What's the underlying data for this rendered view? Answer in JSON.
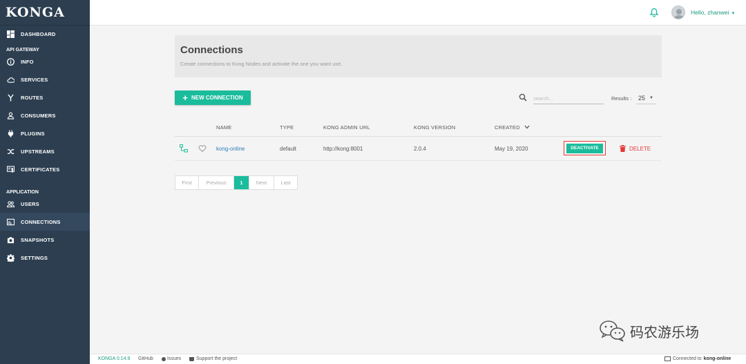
{
  "app": {
    "logo": "KONGA"
  },
  "sidebar": {
    "dashboard": {
      "label": "DASHBOARD"
    },
    "api_gateway_section": "API GATEWAY",
    "api_items": [
      {
        "label": "INFO",
        "icon": "info-icon"
      },
      {
        "label": "SERVICES",
        "icon": "cloud-icon"
      },
      {
        "label": "ROUTES",
        "icon": "routes-icon"
      },
      {
        "label": "CONSUMERS",
        "icon": "user-icon"
      },
      {
        "label": "PLUGINS",
        "icon": "plug-icon"
      },
      {
        "label": "UPSTREAMS",
        "icon": "shuffle-icon"
      },
      {
        "label": "CERTIFICATES",
        "icon": "certificate-icon"
      }
    ],
    "application_section": "APPLICATION",
    "app_items": [
      {
        "label": "USERS",
        "icon": "users-icon"
      },
      {
        "label": "CONNECTIONS",
        "icon": "connections-icon",
        "active": true
      },
      {
        "label": "SNAPSHOTS",
        "icon": "camera-icon"
      },
      {
        "label": "SETTINGS",
        "icon": "gear-icon"
      }
    ]
  },
  "topbar": {
    "user_greeting": "Hello, zhanwei",
    "caret": "▾"
  },
  "main": {
    "title": "Connections",
    "subtitle": "Create connections to Kong Nodes and activate the one you want use.",
    "new_button": "NEW CONNECTION",
    "search_placeholder": "search...",
    "results_label": "Results :",
    "results_value": "25"
  },
  "table": {
    "columns": {
      "name": "NAME",
      "type": "TYPE",
      "url": "KONG ADMIN URL",
      "version": "KONG VERSION",
      "created": "CREATED"
    },
    "rows": [
      {
        "name": "kong-online",
        "type": "default",
        "url": "http://kong:8001",
        "version": "2.0.4",
        "created": "May 19, 2020",
        "action": "DEACTIVATE",
        "delete": "DELETE"
      }
    ]
  },
  "pagination": {
    "first": "First",
    "previous": "Previous",
    "current": "1",
    "next": "Next",
    "last": "Last"
  },
  "footer": {
    "version": "KONGA 0.14.9",
    "github": "GitHub",
    "issues": "Issues",
    "support": "Support the project",
    "connected_prefix": "Connected to",
    "connected_name": "kong-online"
  },
  "watermark": {
    "text": "码农游乐场"
  },
  "colors": {
    "sidebar": "#2c3e50",
    "accent": "#1abc9c",
    "danger": "#e53935",
    "link": "#2c7fb8"
  }
}
